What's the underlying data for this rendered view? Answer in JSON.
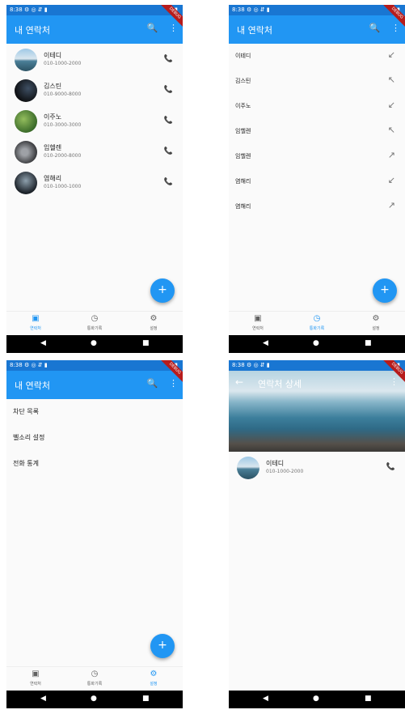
{
  "status": {
    "time": "8:38",
    "icons": "⚙ ◎ ⇵ ▮",
    "right_icons": "▾◢▮",
    "debug_banner": "DEBUG"
  },
  "appbar": {
    "title": "내 연락처",
    "search_icon": "🔍",
    "more_icon": "⋮"
  },
  "contacts": [
    {
      "name": "이테디",
      "phone": "010-1000-2000"
    },
    {
      "name": "김스틴",
      "phone": "010-9000-8000"
    },
    {
      "name": "이주노",
      "phone": "010-3000-3000"
    },
    {
      "name": "임헬렌",
      "phone": "010-2000-8000"
    },
    {
      "name": "염해리",
      "phone": "010-1000-1000"
    }
  ],
  "call_icon": "📞",
  "history": [
    {
      "name": "이테디",
      "type": "incoming",
      "glyph": "↙"
    },
    {
      "name": "김스틴",
      "type": "missed",
      "glyph": "↖"
    },
    {
      "name": "이주노",
      "type": "incoming",
      "glyph": "↙"
    },
    {
      "name": "임헬렌",
      "type": "missed",
      "glyph": "↖"
    },
    {
      "name": "임헬렌",
      "type": "outgoing",
      "glyph": "↗"
    },
    {
      "name": "염해리",
      "type": "incoming",
      "glyph": "↙"
    },
    {
      "name": "염해리",
      "type": "outgoing",
      "glyph": "↗"
    }
  ],
  "settings": [
    "차단 목록",
    "벨소리 설정",
    "전화 통계"
  ],
  "fab_label": "+",
  "nav": {
    "contacts": {
      "label": "연락처",
      "icon": "▣"
    },
    "history": {
      "label": "통화기록",
      "icon": "◷"
    },
    "settings": {
      "label": "설정",
      "icon": "⚙"
    }
  },
  "sysnav": {
    "back": "◀",
    "home": "●",
    "recent": "■"
  },
  "detail": {
    "title": "연락처 상세",
    "back_icon": "←",
    "more_icon": "⋮",
    "contact": {
      "name": "이테디",
      "phone": "010-1000-2000"
    }
  },
  "colors": {
    "primary": "#2196f3",
    "status_bar": "#1976d2",
    "debug": "#b71c1c"
  }
}
